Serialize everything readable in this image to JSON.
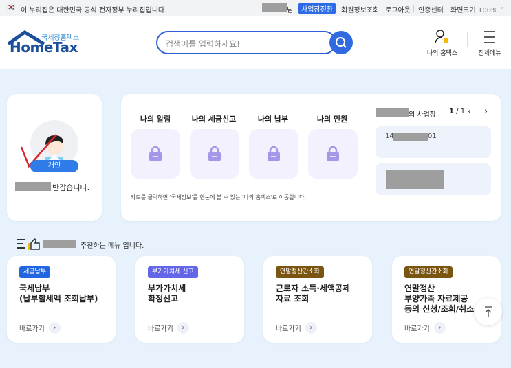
{
  "topbar": {
    "notice": "이 누리집은 대한민국 공식 전자정부 누리집입니다.",
    "user_suffix": "님",
    "switch_label": "사업장전환",
    "links": [
      "회원정보조회",
      "로그아웃",
      "인증센터"
    ],
    "zoom_label": "화면크기",
    "zoom_value": "100%"
  },
  "header": {
    "logo_sub": "국세청홈택스",
    "logo_main": "HomeTax",
    "search_placeholder": "검색어를 입력하세요!",
    "my_hometax": "나의 홈택스",
    "all_menu": "전체메뉴"
  },
  "profile": {
    "badge": "개인",
    "greeting": "반갑습니다."
  },
  "main": {
    "tabs": [
      "나의 알림",
      "나의 세금신고",
      "나의 납부",
      "나의 민원"
    ],
    "note": "카드를 클릭하면 '국세정보'를 한눈에 볼 수 있는 '나의 홈택스'로 이동합니다.",
    "biz_title_suffix": "의 사업장",
    "page_current": "1",
    "page_total": "1",
    "biz_no_start": "14",
    "biz_no_end": "01"
  },
  "recommend": {
    "title_suffix": "추천하는 메뉴 입니다.",
    "go_label": "바로가기",
    "cards": [
      {
        "badge": "세금납부",
        "badge_color": "#2166e0",
        "title": "국세납부\n(납부할세액 조회납부)"
      },
      {
        "badge": "부가가치세 신고",
        "badge_color": "#6366e8",
        "title": "부가가치세\n확정신고"
      },
      {
        "badge": "연말정산간소화",
        "badge_color": "#7a5512",
        "title": "근로자 소득·세액공제\n자료 조회"
      },
      {
        "badge": "연말정산간소화",
        "badge_color": "#7a5512",
        "title": "연말정산\n부양가족 자료제공\n동의 신청/조회/취소"
      }
    ]
  }
}
